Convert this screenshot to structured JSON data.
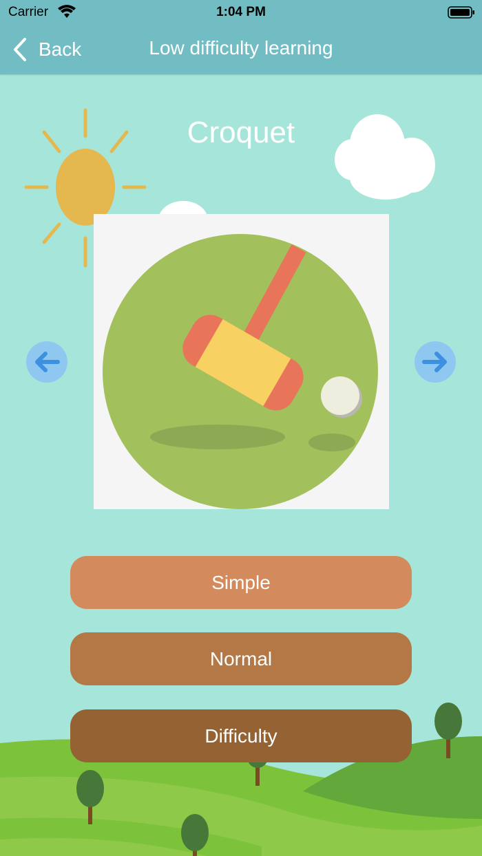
{
  "status_bar": {
    "carrier": "Carrier",
    "time": "1:04 PM",
    "icons": [
      "wifi-icon",
      "battery-icon"
    ]
  },
  "nav": {
    "back_label": "Back",
    "title": "Low difficulty learning"
  },
  "content": {
    "title": "Croquet",
    "image": "croquet-mallet-image"
  },
  "navigation_arrows": {
    "left": "arrow-left-icon",
    "right": "arrow-right-icon"
  },
  "buttons": [
    {
      "label": "Simple",
      "color": "#d38b5d"
    },
    {
      "label": "Normal",
      "color": "#b47846"
    },
    {
      "label": "Difficulty",
      "color": "#946233"
    }
  ],
  "colors": {
    "nav_bar": "#72bdc4",
    "background": "#a6e6da",
    "arrow_bg": "#8ec7f0",
    "arrow_fg": "#3d8fe0"
  }
}
